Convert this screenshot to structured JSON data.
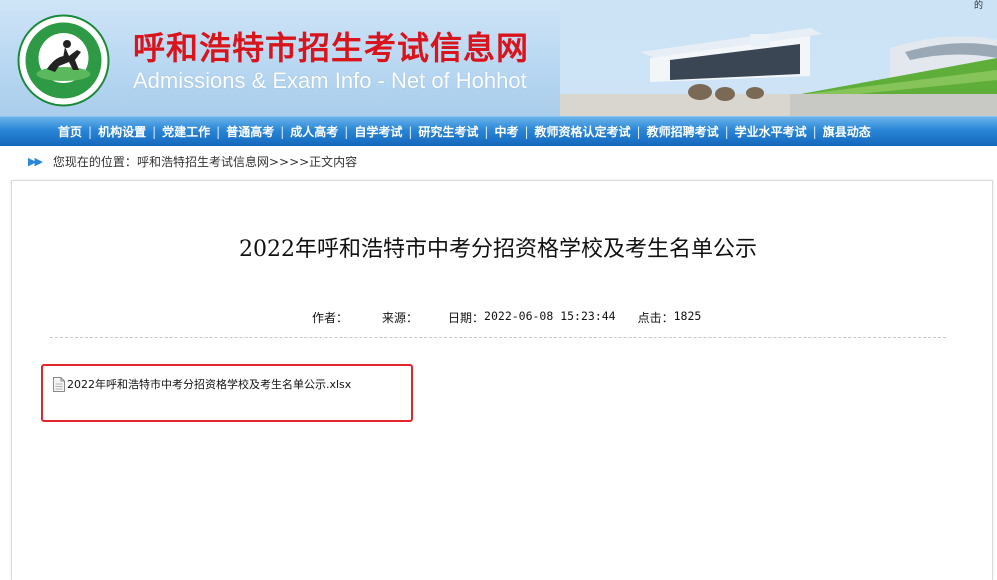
{
  "header": {
    "logo_alt": "HU HE HAO TE SHI",
    "logo_ring_text": "HU HE HAO TE SHI",
    "logo_bottom_text": "呼和浩特",
    "title": "呼和浩特市招生考试信息网",
    "subtitle": "Admissions & Exam Info - Net of Hohhot",
    "corner_mark": "的"
  },
  "nav": {
    "items": [
      {
        "label": "首页"
      },
      {
        "label": "机构设置"
      },
      {
        "label": "党建工作"
      },
      {
        "label": "普通高考"
      },
      {
        "label": "成人高考"
      },
      {
        "label": "自学考试"
      },
      {
        "label": "研究生考试"
      },
      {
        "label": "中考"
      },
      {
        "label": "教师资格认定考试"
      },
      {
        "label": "教师招聘考试"
      },
      {
        "label": "学业水平考试"
      },
      {
        "label": "旗县动态"
      }
    ],
    "separator": "|"
  },
  "breadcrumb": {
    "arrow": "▶▶",
    "prefix": "您现在的位置：",
    "site": "呼和浩特招生考试信息网",
    "suffix": " >>>>正文内容"
  },
  "article": {
    "title": "2022年呼和浩特市中考分招资格学校及考生名单公示",
    "author_label": "作者：",
    "author": "",
    "source_label": "来源：",
    "source": "",
    "date_label": "日期：",
    "date": "2022-06-08 15:23:44",
    "clicks_label": "点击：",
    "clicks": "1825"
  },
  "attachment": {
    "filename": "2022年呼和浩特市中考分招资格学校及考生名单公示.xlsx",
    "icon": "document-icon"
  },
  "colors": {
    "title_red": "#d8141c",
    "nav_blue": "#2a86d6",
    "highlight_red": "#e3242b"
  }
}
